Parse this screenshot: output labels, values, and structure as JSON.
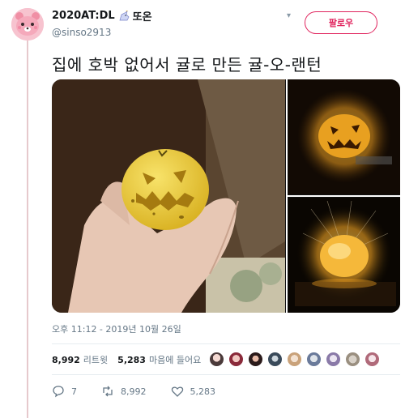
{
  "user": {
    "display_name": "2020AT:DL",
    "name_suffix": "또온",
    "username": "@sinso2913",
    "avatar_icon": "pink-bear-avatar",
    "badge_icon": "unicorn-icon"
  },
  "follow_button": {
    "label": "팔로우"
  },
  "tweet": {
    "text": "집에 호박 없어서 귤로 만든 귤-오-랜턴"
  },
  "media": [
    {
      "description_icon": "hand-holding-orange-lantern"
    },
    {
      "description_icon": "lit-orange-lantern"
    },
    {
      "description_icon": "glowing-orange-lantern"
    }
  ],
  "timestamp": "오후 11:12 - 2019년 10월 26일",
  "stats": {
    "retweets_count": "8,992",
    "retweets_label": "리트윗",
    "likes_count": "5,283",
    "likes_label": "마음에 들어요"
  },
  "actions": {
    "reply_count": "7",
    "retweet_count": "8,992",
    "like_count": "5,283"
  },
  "colors": {
    "follow_accent": "#e0245e",
    "muted_text": "#657786",
    "thread_line": "#e6c9cd"
  }
}
